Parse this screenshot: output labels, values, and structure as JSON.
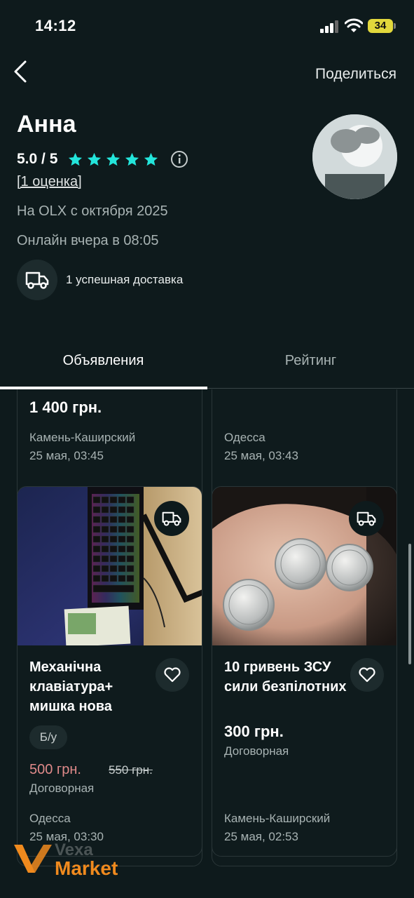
{
  "status_bar": {
    "time": "14:12",
    "battery": "34"
  },
  "header": {
    "share_label": "Поделиться"
  },
  "profile": {
    "name": "Анна",
    "rating": "5.0 / 5",
    "rating_count": "[1 оценка]",
    "member_since": "На OLX с октября 2025",
    "online_status": "Онлайн вчера в 08:05",
    "delivery_text": "1 успешная доставка"
  },
  "tabs": [
    {
      "label": "Объявления",
      "active": true
    },
    {
      "label": "Рейтинг",
      "active": false
    }
  ],
  "listings": [
    {
      "price": "1 400 грн.",
      "city": "Камень-Каширский",
      "date": "25 мая, 03:45"
    },
    {
      "price": "",
      "city": "Одесса",
      "date": "25 мая, 03:43"
    },
    {
      "title": "Механічна клавіатура+ мишка нова",
      "condition": "Б/у",
      "price": "500 грн.",
      "old_price": "550 грн.",
      "negotiable": "Договорная",
      "city": "Одесса",
      "date": "25 мая, 03:30"
    },
    {
      "title": "10 гривень ЗСУ сили безпілотних",
      "price": "300 грн.",
      "negotiable": "Договорная",
      "city": "Камень-Каширский",
      "date": "25 мая, 02:53"
    }
  ],
  "watermark": {
    "line1": "Vexa",
    "line2": "Market"
  },
  "colors": {
    "background": "#0e1a1c",
    "star": "#23e5db",
    "sale_price": "#e08a8a",
    "battery": "#e2d83c",
    "watermark": "#f08a1e"
  }
}
